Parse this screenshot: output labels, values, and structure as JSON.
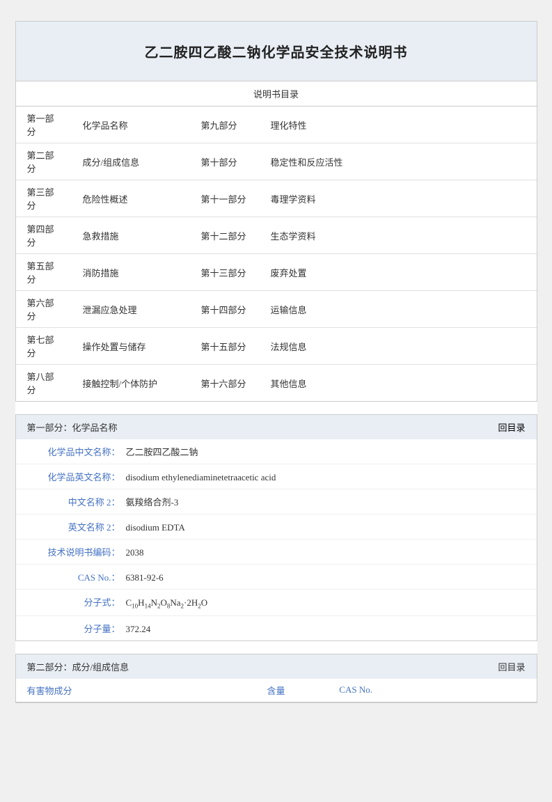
{
  "page": {
    "background": "#f0f0f0"
  },
  "title": "乙二胺四乙酸二钠化学品安全技术说明书",
  "toc": {
    "header": "说明书目录",
    "rows": [
      {
        "col1_num": "第一部分",
        "col1_name": "化学品名称",
        "col2_num": "第九部分",
        "col2_name": "理化特性"
      },
      {
        "col1_num": "第二部分",
        "col1_name": "成分/组成信息",
        "col2_num": "第十部分",
        "col2_name": "稳定性和反应活性"
      },
      {
        "col1_num": "第三部分",
        "col1_name": "危险性概述",
        "col2_num": "第十一部分",
        "col2_name": "毒理学资料"
      },
      {
        "col1_num": "第四部分",
        "col1_name": "急救措施",
        "col2_num": "第十二部分",
        "col2_name": "生态学资料"
      },
      {
        "col1_num": "第五部分",
        "col1_name": "消防措施",
        "col2_num": "第十三部分",
        "col2_name": "废弃处置"
      },
      {
        "col1_num": "第六部分",
        "col1_name": "泄漏应急处理",
        "col2_num": "第十四部分",
        "col2_name": "运输信息"
      },
      {
        "col1_num": "第七部分",
        "col1_name": "操作处置与储存",
        "col2_num": "第十五部分",
        "col2_name": "法规信息"
      },
      {
        "col1_num": "第八部分",
        "col1_name": "接触控制/个体防护",
        "col2_num": "第十六部分",
        "col2_name": "其他信息"
      }
    ]
  },
  "part1": {
    "header": "第一部分：化学品名称",
    "back_link": "回目录",
    "fields": [
      {
        "label": "化学品中文名称：",
        "value": "乙二胺四乙酸二钠"
      },
      {
        "label": "化学品英文名称：",
        "value": "disodium ethylenediaminetetraacetic acid"
      },
      {
        "label": "中文名称 2：",
        "value": "氨羧络合剂-3"
      },
      {
        "label": "英文名称 2：",
        "value": "disodium EDTA"
      },
      {
        "label": "技术说明书编码：",
        "value": "2038"
      },
      {
        "label": "CAS No.：",
        "value": "6381-92-6"
      },
      {
        "label": "分子式：",
        "value": "C₁₀H₁₄N₂O₈Na₂·2H₂O"
      },
      {
        "label": "分子量：",
        "value": "372.24"
      }
    ]
  },
  "part2": {
    "header": "第二部分：成分/组成信息",
    "back_link": "回目录",
    "table_headers": {
      "col1": "有害物成分",
      "col2": "含量",
      "col3": "CAS No."
    }
  }
}
